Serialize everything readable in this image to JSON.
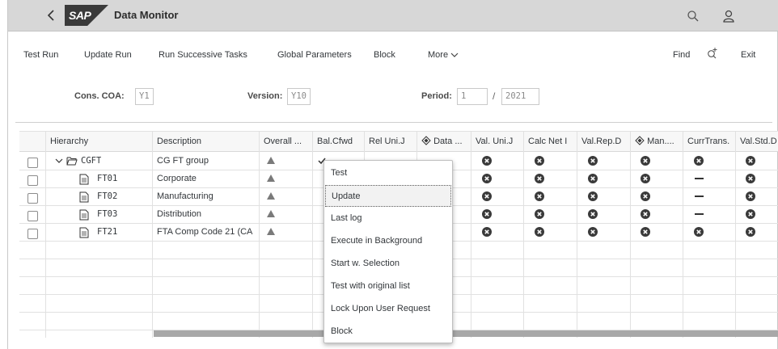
{
  "shell": {
    "logo_text": "SAP",
    "title": "Data Monitor",
    "back_icon": "back-chevron-icon",
    "search_icon": "search-icon",
    "user_icon": "user-icon"
  },
  "toolbar": {
    "test_run": "Test Run",
    "update_run": "Update Run",
    "run_successive": "Run Successive Tasks",
    "global_params": "Global Parameters",
    "block": "Block",
    "more": "More",
    "find": "Find",
    "exit": "Exit"
  },
  "filters": {
    "cons_coa_label": "Cons. COA:",
    "cons_coa_value": "Y1",
    "version_label": "Version:",
    "version_value": "Y10",
    "period_label": "Period:",
    "period_value": "1",
    "period_sep": "/",
    "year_value": "2021"
  },
  "table": {
    "columns": [
      "Hierarchy",
      "Description",
      "Overall ...",
      "Bal.Cfwd",
      "Rel Uni.J",
      "Data ...",
      "Val. Uni.J",
      "Calc Net I",
      "Val.Rep.D",
      "Man....",
      "CurrTrans.",
      "Val.Std.D"
    ],
    "rows": [
      {
        "id": "CGFT",
        "desc": "CG FT group",
        "curr": "x"
      },
      {
        "id": "FT01",
        "desc": "Corporate",
        "curr": "dash"
      },
      {
        "id": "FT02",
        "desc": "Manufacturing",
        "curr": "dash"
      },
      {
        "id": "FT03",
        "desc": "Distribution",
        "curr": "dash"
      },
      {
        "id": "FT21",
        "desc": "FTA Comp Code 21 (CA",
        "curr": "x"
      }
    ]
  },
  "context_menu": {
    "items": [
      "Test",
      "Update",
      "Last log",
      "Execute in Background",
      "Start w. Selection",
      "Test with original list",
      "Lock Upon User Request",
      "Block"
    ],
    "selected": "Update"
  },
  "colors": {
    "shell_bg": "#d7d7d7",
    "status_icon": "#3a3a3a",
    "warning_triangle": "#7a7a7a"
  }
}
